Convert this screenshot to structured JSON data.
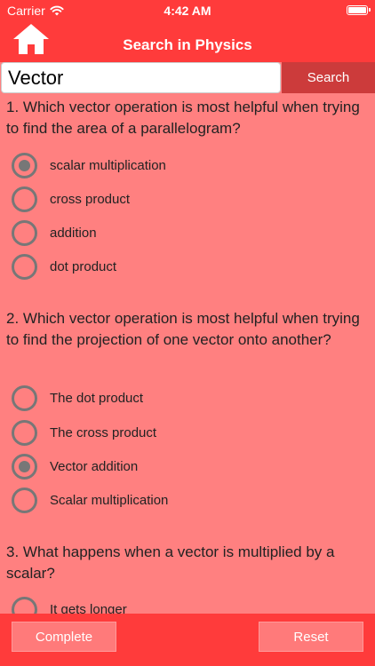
{
  "status_bar": {
    "carrier": "Carrier",
    "time": "4:42 AM"
  },
  "header": {
    "home_icon": "home-icon",
    "title": "Search in Physics"
  },
  "search": {
    "value": "Vector",
    "button_label": "Search"
  },
  "questions": [
    {
      "text": "1. Which vector operation is most helpful when trying to find the area of a parallelogram?",
      "options": [
        {
          "label": "scalar multiplication",
          "selected": true
        },
        {
          "label": "cross product",
          "selected": false
        },
        {
          "label": "addition",
          "selected": false
        },
        {
          "label": "dot product",
          "selected": false
        }
      ]
    },
    {
      "text": "2. Which vector operation is most helpful when trying to find the projection of one vector onto another?",
      "options": [
        {
          "label": "The dot product",
          "selected": false
        },
        {
          "label": "The cross product",
          "selected": false
        },
        {
          "label": "Vector addition",
          "selected": true
        },
        {
          "label": "Scalar multiplication",
          "selected": false
        }
      ]
    },
    {
      "text": "3. What happens when a vector is multiplied by a scalar?",
      "options": [
        {
          "label": "It gets longer",
          "selected": false
        }
      ]
    }
  ],
  "footer": {
    "complete_label": "Complete",
    "reset_label": "Reset"
  },
  "colors": {
    "header": "#ff3b3b",
    "background": "#ff8080",
    "search_button": "#cc3b3b"
  }
}
